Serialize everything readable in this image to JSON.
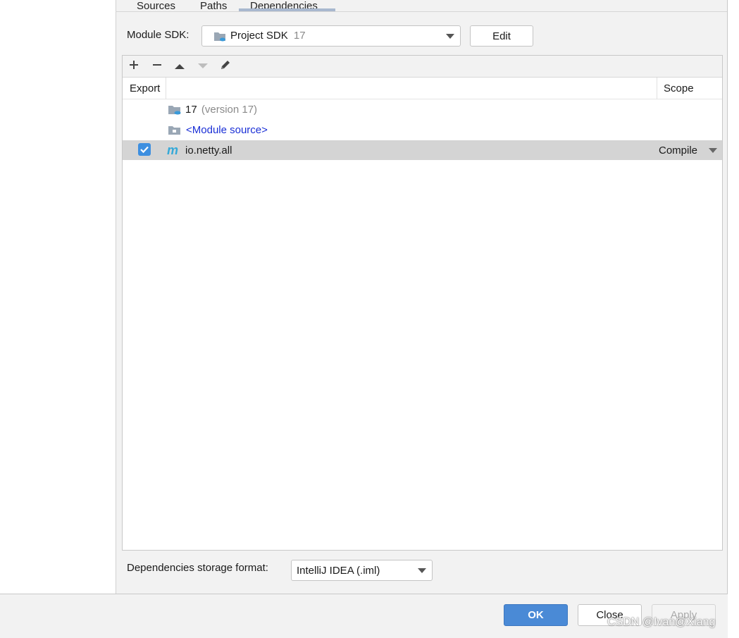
{
  "tabs": [
    {
      "label": "Sources"
    },
    {
      "label": "Paths"
    },
    {
      "label": "Dependencies"
    }
  ],
  "module_sdk": {
    "label": "Module SDK:",
    "value": "Project SDK",
    "version": "17",
    "edit_label": "Edit"
  },
  "toolbar": {
    "add": "+",
    "remove": "−"
  },
  "table": {
    "col_export": "Export",
    "col_scope": "Scope",
    "rows": [
      {
        "name": "17",
        "detail": "(version 17)"
      },
      {
        "name": "<Module source>"
      },
      {
        "name": "io.netty.all",
        "scope": "Compile",
        "exported": true
      }
    ]
  },
  "storage": {
    "label": "Dependencies storage format:",
    "value": "IntelliJ IDEA (.iml)"
  },
  "footer": {
    "ok": "OK",
    "close": "Close",
    "apply": "Apply"
  },
  "watermark": "CSDN @Ivan@Xiang",
  "colors": {
    "accent": "#4a8ad6",
    "link": "#1a2fd6",
    "selection": "#d4d4d4"
  }
}
